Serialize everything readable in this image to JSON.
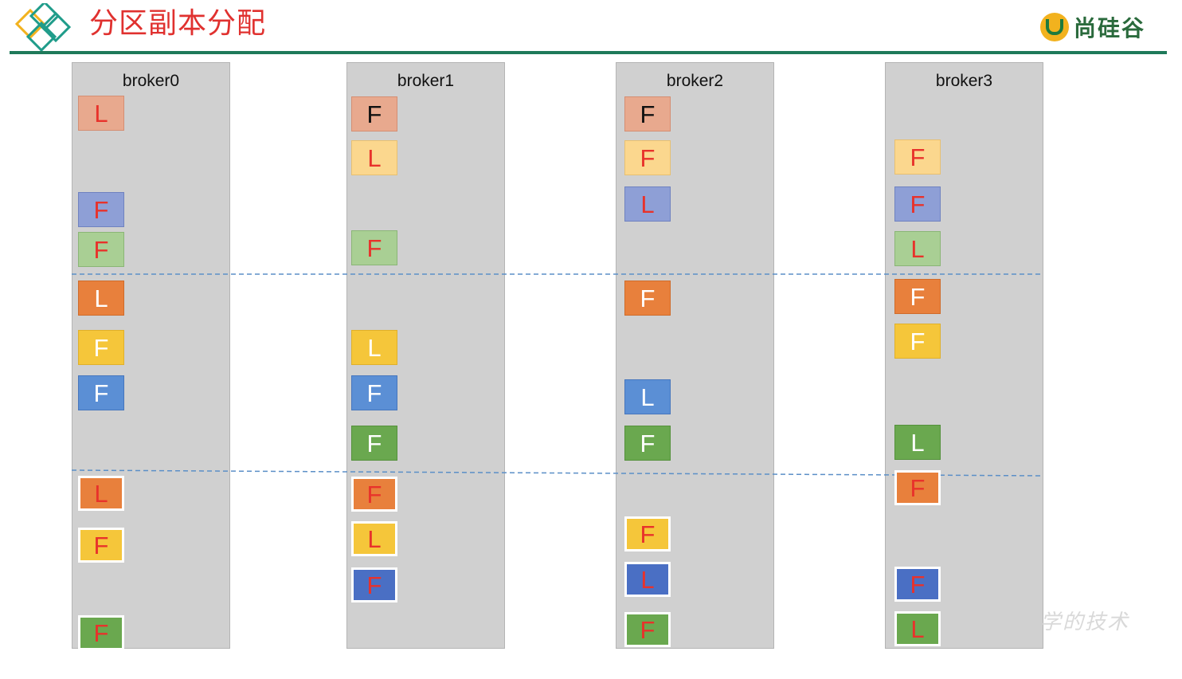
{
  "title": "分区副本分配",
  "brand": {
    "name": "尚硅谷",
    "icon": "u-logo-icon"
  },
  "watermark": "学的技术",
  "colors": {
    "header_rule": "#1f7a5a",
    "title": "#e0312f",
    "divider": "#5b8fc7",
    "broker_bg": "#d0d0d0"
  },
  "brokers": [
    {
      "name": "broker0",
      "replicas": [
        {
          "role": "L",
          "fill": "#e8a98e",
          "border": "#d58e72",
          "text": "#e8322b"
        },
        {
          "role": "F",
          "fill": "#8e9fd6",
          "border": "#6f82c0",
          "text": "#e8322b"
        },
        {
          "role": "F",
          "fill": "#a9cf94",
          "border": "#8ab676",
          "text": "#e8322b"
        },
        {
          "role": "L",
          "fill": "#e8803c",
          "border": "#cf6b2a",
          "text": "#ffffff"
        },
        {
          "role": "F",
          "fill": "#f5c63a",
          "border": "#e0b02a",
          "text": "#ffffff"
        },
        {
          "role": "F",
          "fill": "#5b8fd5",
          "border": "#4676bd",
          "text": "#ffffff"
        },
        {
          "role": "L",
          "fill": "#e8803c",
          "border": "#ffffff",
          "text": "#e8322b"
        },
        {
          "role": "F",
          "fill": "#f5c63a",
          "border": "#ffffff",
          "text": "#e8322b"
        },
        {
          "role": "F",
          "fill": "#6aa84f",
          "border": "#ffffff",
          "text": "#e8322b"
        }
      ]
    },
    {
      "name": "broker1",
      "replicas": [
        {
          "role": "F",
          "fill": "#e8a98e",
          "border": "#d58e72",
          "text": "#111111"
        },
        {
          "role": "L",
          "fill": "#fbd78e",
          "border": "#e8c070",
          "text": "#e8322b"
        },
        {
          "role": "F",
          "fill": "#a9cf94",
          "border": "#8ab676",
          "text": "#e8322b"
        },
        {
          "role": "L",
          "fill": "#f5c63a",
          "border": "#e0b02a",
          "text": "#ffffff"
        },
        {
          "role": "F",
          "fill": "#5b8fd5",
          "border": "#4676bd",
          "text": "#ffffff"
        },
        {
          "role": "F",
          "fill": "#6aa84f",
          "border": "#54913b",
          "text": "#ffffff"
        },
        {
          "role": "F",
          "fill": "#e8803c",
          "border": "#ffffff",
          "text": "#e8322b"
        },
        {
          "role": "L",
          "fill": "#f5c63a",
          "border": "#ffffff",
          "text": "#e8322b"
        },
        {
          "role": "F",
          "fill": "#4a6fc4",
          "border": "#ffffff",
          "text": "#e8322b"
        }
      ]
    },
    {
      "name": "broker2",
      "replicas": [
        {
          "role": "F",
          "fill": "#e8a98e",
          "border": "#d58e72",
          "text": "#111111"
        },
        {
          "role": "F",
          "fill": "#fbd78e",
          "border": "#e8c070",
          "text": "#e8322b"
        },
        {
          "role": "L",
          "fill": "#8e9fd6",
          "border": "#6f82c0",
          "text": "#e8322b"
        },
        {
          "role": "F",
          "fill": "#e8803c",
          "border": "#cf6b2a",
          "text": "#ffffff"
        },
        {
          "role": "L",
          "fill": "#5b8fd5",
          "border": "#4676bd",
          "text": "#ffffff"
        },
        {
          "role": "F",
          "fill": "#6aa84f",
          "border": "#54913b",
          "text": "#ffffff"
        },
        {
          "role": "F",
          "fill": "#f5c63a",
          "border": "#ffffff",
          "text": "#e8322b"
        },
        {
          "role": "L",
          "fill": "#4a6fc4",
          "border": "#ffffff",
          "text": "#e8322b"
        },
        {
          "role": "F",
          "fill": "#6aa84f",
          "border": "#ffffff",
          "text": "#e8322b"
        }
      ]
    },
    {
      "name": "broker3",
      "replicas": [
        {
          "role": "F",
          "fill": "#fbd78e",
          "border": "#e8c070",
          "text": "#e8322b"
        },
        {
          "role": "F",
          "fill": "#8e9fd6",
          "border": "#6f82c0",
          "text": "#e8322b"
        },
        {
          "role": "L",
          "fill": "#a9cf94",
          "border": "#8ab676",
          "text": "#e8322b"
        },
        {
          "role": "F",
          "fill": "#e8803c",
          "border": "#cf6b2a",
          "text": "#ffffff"
        },
        {
          "role": "F",
          "fill": "#f5c63a",
          "border": "#e0b02a",
          "text": "#ffffff"
        },
        {
          "role": "L",
          "fill": "#6aa84f",
          "border": "#54913b",
          "text": "#ffffff"
        },
        {
          "role": "F",
          "fill": "#e8803c",
          "border": "#ffffff",
          "text": "#e8322b"
        },
        {
          "role": "F",
          "fill": "#4a6fc4",
          "border": "#ffffff",
          "text": "#e8322b"
        },
        {
          "role": "L",
          "fill": "#6aa84f",
          "border": "#ffffff",
          "text": "#e8322b"
        }
      ]
    }
  ]
}
